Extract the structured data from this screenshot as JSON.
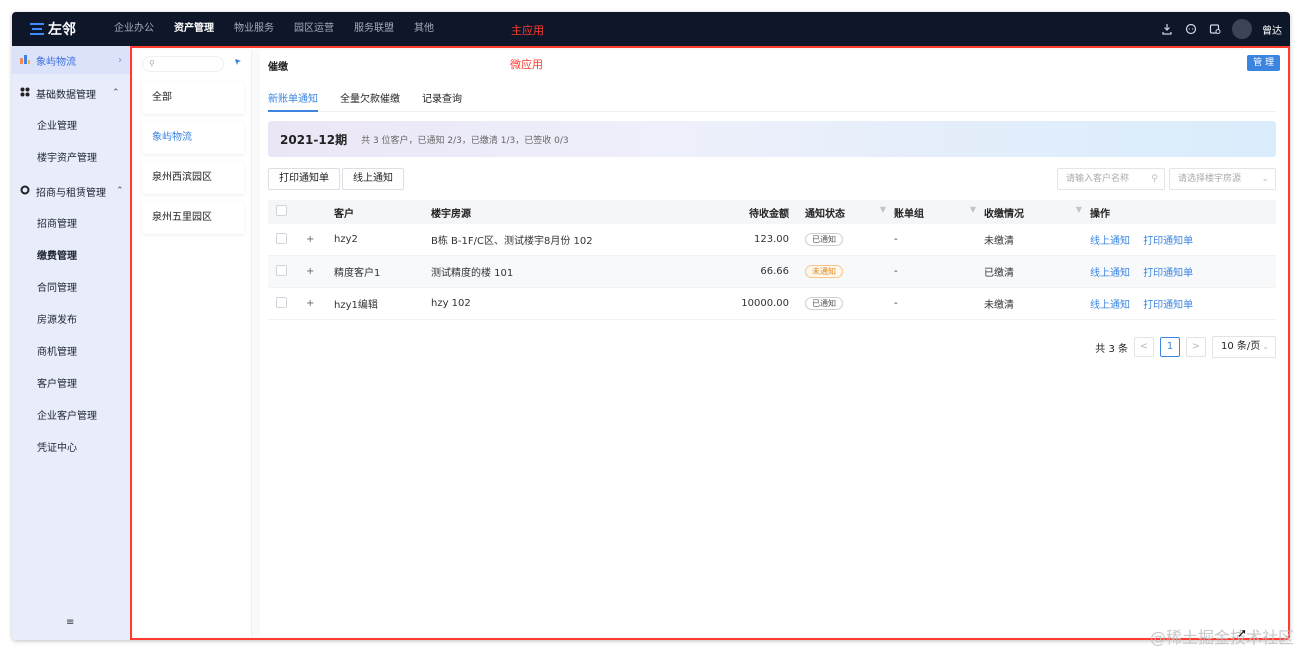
{
  "topbar": {
    "logo": "左邻",
    "nav": [
      "企业办公",
      "资产管理",
      "物业服务",
      "园区运营",
      "服务联盟",
      "其他"
    ],
    "active_nav": "资产管理",
    "main_app_label": "主应用",
    "username": "曾达",
    "icons": [
      "download-icon",
      "chat-icon",
      "notification-icon",
      "avatar"
    ]
  },
  "sidebar": {
    "current_park": "象屿物流",
    "groups": [
      {
        "label": "基础数据管理",
        "items": [
          "企业管理",
          "楼宇资产管理"
        ]
      },
      {
        "label": "招商与租赁管理",
        "items": [
          "招商管理",
          "缴费管理",
          "合同管理",
          "房源发布",
          "商机管理",
          "客户管理",
          "企业客户管理",
          "凭证中心"
        ]
      }
    ],
    "collapse_icon": "≡"
  },
  "parks": {
    "search_placeholder": "",
    "items": [
      "全部",
      "象屿物流",
      "泉州西滨园区",
      "泉州五里园区"
    ],
    "active": "象屿物流"
  },
  "content": {
    "title": "催缴",
    "micro_app_label": "微应用",
    "manage_button": "管 理",
    "tabs": [
      "新账单通知",
      "全量欠款催缴",
      "记录查询"
    ],
    "active_tab": "新账单通知",
    "period_title": "2021-12期",
    "period_summary": "共 3 位客户，已通知 2/3，已缴清 1/3，已签收 0/3",
    "btn_print": "打印通知单",
    "btn_online": "线上通知",
    "customer_placeholder": "请输入客户名称",
    "room_placeholder": "请选择楼宇房源"
  },
  "table": {
    "columns": [
      "客户",
      "楼宇房源",
      "待收金额",
      "通知状态",
      "账单组",
      "收缴情况",
      "操作"
    ],
    "rows": [
      {
        "expand": "+",
        "customer": "hzy2",
        "room": "B栋 B-1F/C区、测试楼宇8月份 102",
        "amount": "123.00",
        "status": "已通知",
        "status_type": "done",
        "group": "-",
        "payment": "未缴清",
        "op1": "线上通知",
        "op2": "打印通知单"
      },
      {
        "expand": "+",
        "customer": "精度客户1",
        "room": "测试精度的楼 101",
        "amount": "66.66",
        "status": "未通知",
        "status_type": "warn",
        "group": "-",
        "payment": "已缴清",
        "op1": "线上通知",
        "op2": "打印通知单"
      },
      {
        "expand": "+",
        "customer": "hzy1编辑",
        "room": "hzy 102",
        "amount": "10000.00",
        "status": "已通知",
        "status_type": "done",
        "group": "-",
        "payment": "未缴清",
        "op1": "线上通知",
        "op2": "打印通知单"
      }
    ]
  },
  "pager": {
    "total": "共 3 条",
    "prev": "<",
    "current": "1",
    "next": ">",
    "page_size": "10 条/页"
  },
  "watermark": "@稀土掘金技术社区",
  "colors": {
    "accent": "#3b85e0",
    "topbar_bg": "#0e1729",
    "highlight_border": "#ff3b30",
    "warn": "#e38a1c"
  }
}
